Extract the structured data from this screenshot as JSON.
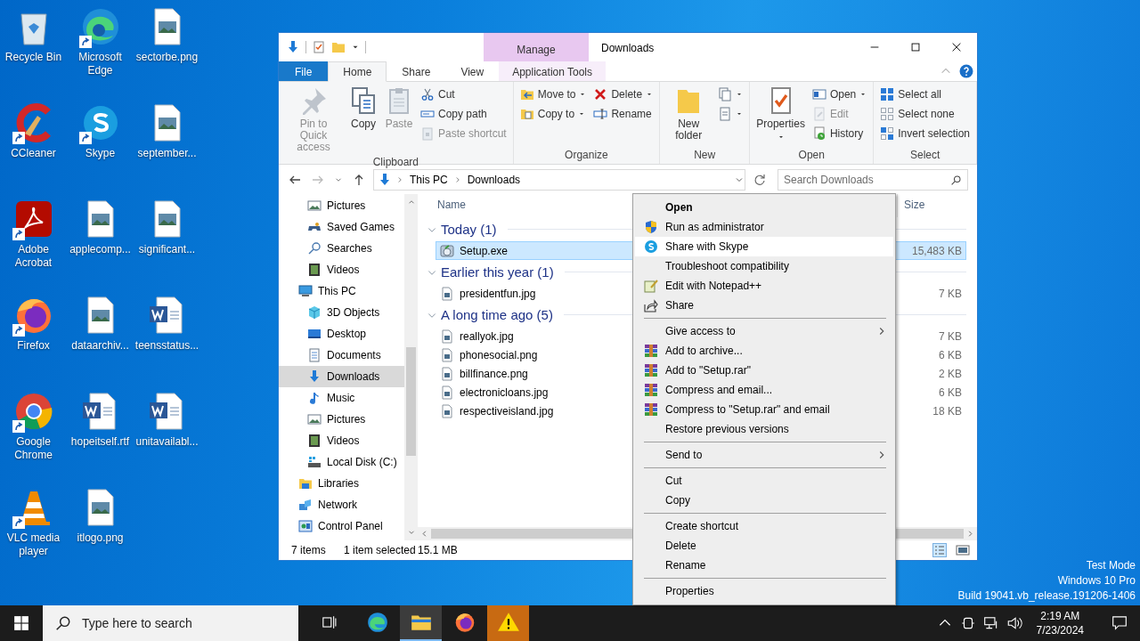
{
  "desktop_icons": [
    {
      "label": "Recycle Bin",
      "kind": "recycle",
      "shortcut": false
    },
    {
      "label": "Microsoft Edge",
      "kind": "edge",
      "shortcut": true
    },
    {
      "label": "sectorbe.png",
      "kind": "image",
      "shortcut": false
    },
    {
      "label": "CCleaner",
      "kind": "ccleaner",
      "shortcut": true
    },
    {
      "label": "Skype",
      "kind": "skype",
      "shortcut": true
    },
    {
      "label": "september...",
      "kind": "image",
      "shortcut": false
    },
    {
      "label": "Adobe Acrobat",
      "kind": "acrobat",
      "shortcut": true
    },
    {
      "label": "applecomp...",
      "kind": "image",
      "shortcut": false
    },
    {
      "label": "significant...",
      "kind": "image",
      "shortcut": false
    },
    {
      "label": "Firefox",
      "kind": "firefox",
      "shortcut": true
    },
    {
      "label": "dataarchiv...",
      "kind": "image",
      "shortcut": false
    },
    {
      "label": "teensstatus...",
      "kind": "word",
      "shortcut": false
    },
    {
      "label": "Google Chrome",
      "kind": "chrome",
      "shortcut": true
    },
    {
      "label": "hopeitself.rtf",
      "kind": "word",
      "shortcut": false
    },
    {
      "label": "unitavailabl...",
      "kind": "word",
      "shortcut": false
    },
    {
      "label": "VLC media player",
      "kind": "vlc",
      "shortcut": true
    },
    {
      "label": "itlogo.png",
      "kind": "image",
      "shortcut": false
    }
  ],
  "explorer": {
    "title": "Downloads",
    "contextual_tab": "Manage",
    "tabs": [
      {
        "label": "File",
        "kind": "file",
        "selected": false
      },
      {
        "label": "Home",
        "kind": "normal",
        "selected": true
      },
      {
        "label": "Share",
        "kind": "normal",
        "selected": false
      },
      {
        "label": "View",
        "kind": "normal",
        "selected": false
      },
      {
        "label": "Application Tools",
        "kind": "contextual",
        "selected": false
      }
    ],
    "ribbon": [
      {
        "title": "Clipboard",
        "controls": [
          {
            "kind": "large",
            "buttons": [
              {
                "label": "Pin to Quick access",
                "kind": "pin",
                "disabled": true,
                "dropdown": false
              }
            ]
          },
          {
            "kind": "large",
            "buttons": [
              {
                "label": "Copy",
                "kind": "copy",
                "disabled": false,
                "dropdown": false
              }
            ]
          },
          {
            "kind": "large",
            "buttons": [
              {
                "label": "Paste",
                "kind": "paste",
                "disabled": true,
                "dropdown": false
              }
            ]
          },
          {
            "kind": "stack",
            "buttons": [
              {
                "label": "Cut",
                "kind": "cut",
                "disabled": false,
                "dropdown": false
              },
              {
                "label": "Copy path",
                "kind": "copypath",
                "disabled": false,
                "dropdown": false
              },
              {
                "label": "Paste shortcut",
                "kind": "pasteshortcut",
                "disabled": true,
                "dropdown": false
              }
            ]
          }
        ]
      },
      {
        "title": "Organize",
        "controls": [
          {
            "kind": "stack",
            "buttons": [
              {
                "label": "Move to",
                "kind": "moveto",
                "disabled": false,
                "dropdown": true
              },
              {
                "label": "Copy to",
                "kind": "copyto",
                "disabled": false,
                "dropdown": true
              }
            ]
          },
          {
            "kind": "stack",
            "buttons": [
              {
                "label": "Delete",
                "kind": "delete",
                "disabled": false,
                "dropdown": true
              },
              {
                "label": "Rename",
                "kind": "rename",
                "disabled": false,
                "dropdown": false
              }
            ]
          }
        ]
      },
      {
        "title": "New",
        "controls": [
          {
            "kind": "large",
            "buttons": [
              {
                "label": "New folder",
                "kind": "newfolder",
                "disabled": false,
                "dropdown": false
              }
            ]
          },
          {
            "kind": "stack",
            "buttons": [
              {
                "kind": "newitem",
                "disabled": false,
                "dropdown": true
              },
              {
                "kind": "easyaccess",
                "disabled": false,
                "dropdown": true
              }
            ]
          }
        ]
      },
      {
        "title": "Open",
        "controls": [
          {
            "kind": "large",
            "buttons": [
              {
                "label": "Properties",
                "kind": "properties",
                "disabled": false,
                "dropdown": true
              }
            ]
          },
          {
            "kind": "stack",
            "buttons": [
              {
                "label": "Open",
                "kind": "open",
                "disabled": false,
                "dropdown": true
              },
              {
                "label": "Edit",
                "kind": "edit",
                "disabled": true,
                "dropdown": false
              },
              {
                "label": "History",
                "kind": "history",
                "disabled": false,
                "dropdown": false
              }
            ]
          }
        ]
      },
      {
        "title": "Select",
        "controls": [
          {
            "kind": "stack",
            "buttons": [
              {
                "label": "Select all",
                "kind": "selectall",
                "disabled": false,
                "dropdown": false
              },
              {
                "label": "Select none",
                "kind": "selectnone",
                "disabled": false,
                "dropdown": false
              },
              {
                "label": "Invert selection",
                "kind": "invert",
                "disabled": false,
                "dropdown": false
              }
            ]
          }
        ]
      }
    ],
    "address": [
      "This PC",
      "Downloads"
    ],
    "search": {
      "placeholder": "Search Downloads"
    },
    "nav_pane": [
      {
        "children": [
          {
            "label": "Pictures",
            "kind": "picture",
            "selected": false
          },
          {
            "label": "Saved Games",
            "kind": "games",
            "selected": false
          },
          {
            "label": "Searches",
            "kind": "searchfolder",
            "selected": false
          },
          {
            "label": "Videos",
            "kind": "video",
            "selected": false
          }
        ]
      },
      {
        "label": "This PC",
        "kind": "pc",
        "selected": false,
        "children": [
          {
            "label": "3D Objects",
            "kind": "cube",
            "selected": false
          },
          {
            "label": "Desktop",
            "kind": "desktop",
            "selected": false
          },
          {
            "label": "Documents",
            "kind": "docs",
            "selected": false
          },
          {
            "label": "Downloads",
            "kind": "dl",
            "selected": true
          },
          {
            "label": "Music",
            "kind": "music",
            "selected": false
          },
          {
            "label": "Pictures",
            "kind": "picture",
            "selected": false
          },
          {
            "label": "Videos",
            "kind": "video",
            "selected": false
          },
          {
            "label": "Local Disk (C:)",
            "kind": "disk",
            "selected": false
          }
        ]
      },
      {
        "label": "Libraries",
        "kind": "libraries",
        "selected": false
      },
      {
        "label": "Network",
        "kind": "network",
        "selected": false
      },
      {
        "label": "Control Panel",
        "kind": "control",
        "selected": false
      }
    ],
    "columns": [
      "Name",
      "Size"
    ],
    "groups": [
      {
        "title": "Today (1)",
        "expanded": true,
        "files": [
          {
            "name": "Setup.exe",
            "size": "15,483 KB",
            "kind": "exe",
            "selected": true
          }
        ]
      },
      {
        "title": "Earlier this year (1)",
        "expanded": true,
        "files": [
          {
            "name": "presidentfun.jpg",
            "size": "7 KB",
            "kind": "image",
            "selected": false
          }
        ]
      },
      {
        "title": "A long time ago (5)",
        "expanded": true,
        "files": [
          {
            "name": "reallyok.jpg",
            "size": "7 KB",
            "kind": "image",
            "selected": false
          },
          {
            "name": "phonesocial.png",
            "size": "6 KB",
            "kind": "image",
            "selected": false
          },
          {
            "name": "billfinance.png",
            "size": "2 KB",
            "kind": "image",
            "selected": false
          },
          {
            "name": "electronicloans.jpg",
            "size": "6 KB",
            "kind": "image",
            "selected": false
          },
          {
            "name": "respectiveisland.jpg",
            "size": "18 KB",
            "kind": "image",
            "selected": false
          }
        ]
      }
    ],
    "status": {
      "count": "7 items",
      "selection": "1 item selected",
      "size": "15.1 MB"
    }
  },
  "context_menu": [
    {
      "kind": "plain",
      "label": "Open",
      "default": true,
      "selected": false
    },
    {
      "kind": "shield",
      "label": "Run as administrator",
      "selected": false
    },
    {
      "kind": "skype",
      "label": "Share with Skype",
      "selected": true
    },
    {
      "kind": "plain",
      "label": "Troubleshoot compatibility",
      "selected": false
    },
    {
      "kind": "notepad",
      "label": "Edit with Notepad++",
      "selected": false
    },
    {
      "kind": "share",
      "label": "Share",
      "selected": false
    },
    {
      "kind": "separator"
    },
    {
      "kind": "plain",
      "label": "Give access to",
      "submenu": true,
      "selected": false
    },
    {
      "kind": "winrar",
      "label": "Add to archive...",
      "selected": false
    },
    {
      "kind": "winrar",
      "label": "Add to \"Setup.rar\"",
      "selected": false
    },
    {
      "kind": "winrar",
      "label": "Compress and email...",
      "selected": false
    },
    {
      "kind": "winrar",
      "label": "Compress to \"Setup.rar\" and email",
      "selected": false
    },
    {
      "kind": "plain",
      "label": "Restore previous versions",
      "selected": false
    },
    {
      "kind": "separator"
    },
    {
      "kind": "plain",
      "label": "Send to",
      "submenu": true,
      "selected": false
    },
    {
      "kind": "separator"
    },
    {
      "kind": "plain",
      "label": "Cut",
      "selected": false
    },
    {
      "kind": "plain",
      "label": "Copy",
      "selected": false
    },
    {
      "kind": "separator"
    },
    {
      "kind": "plain",
      "label": "Create shortcut",
      "selected": false
    },
    {
      "kind": "plain",
      "label": "Delete",
      "selected": false
    },
    {
      "kind": "plain",
      "label": "Rename",
      "selected": false
    },
    {
      "kind": "separator"
    },
    {
      "kind": "plain",
      "label": "Properties",
      "selected": false
    }
  ],
  "system_notice": [
    "Test Mode",
    "Windows 10 Pro",
    "Build 19041.vb_release.191206-1406"
  ],
  "taskbar": {
    "search_placeholder": "Type here to search",
    "apps": [
      {
        "kind": "edge",
        "selected": false
      },
      {
        "kind": "explorer",
        "selected": true
      },
      {
        "kind": "firefox",
        "selected": false
      },
      {
        "kind": "warning",
        "selected": false
      }
    ],
    "time": "2:19 AM",
    "date": "7/23/2024"
  }
}
